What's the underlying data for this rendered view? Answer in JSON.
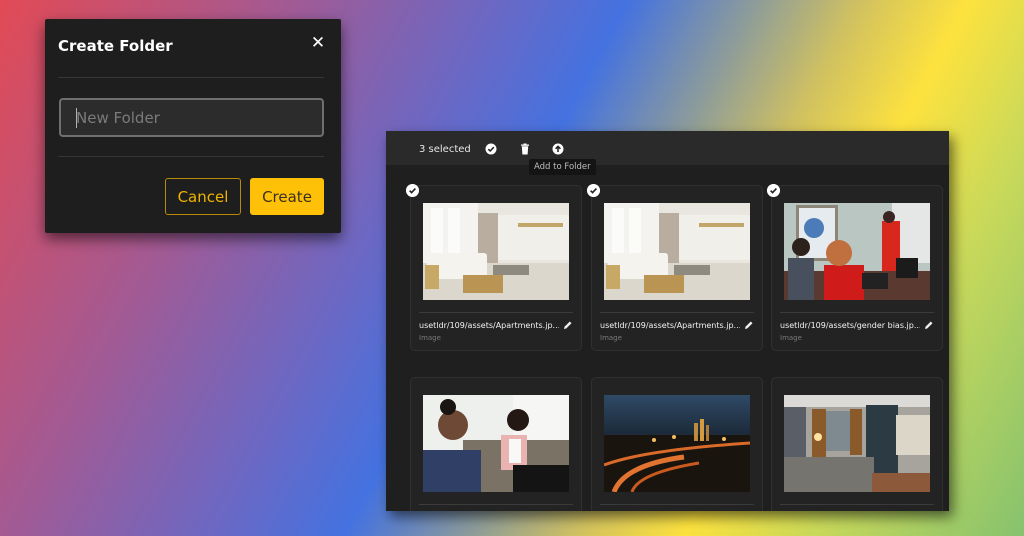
{
  "dialog": {
    "title": "Create Folder",
    "close_icon": "close-icon",
    "input_placeholder": "New Folder",
    "input_value": "",
    "cancel_label": "Cancel",
    "create_label": "Create",
    "accent_color": "#ffc107"
  },
  "toolbar": {
    "selected_count": "3 selected",
    "icons": [
      "check-circle-icon",
      "trash-icon",
      "upload-icon"
    ],
    "tooltip": "Add to Folder"
  },
  "assets": [
    {
      "name": "usetldr/109/assets/Apartments.jp...",
      "type": "Image",
      "selected": true,
      "thumbnail": "living-room"
    },
    {
      "name": "usetldr/109/assets/Apartments.jp...",
      "type": "Image",
      "selected": true,
      "thumbnail": "living-room"
    },
    {
      "name": "usetldr/109/assets/gender bias.jp...",
      "type": "Image",
      "selected": true,
      "thumbnail": "office-meeting"
    },
    {
      "name": "",
      "type": "",
      "selected": false,
      "thumbnail": "two-women-couch"
    },
    {
      "name": "",
      "type": "",
      "selected": false,
      "thumbnail": "city-night"
    },
    {
      "name": "",
      "type": "",
      "selected": false,
      "thumbnail": "bedroom"
    }
  ]
}
